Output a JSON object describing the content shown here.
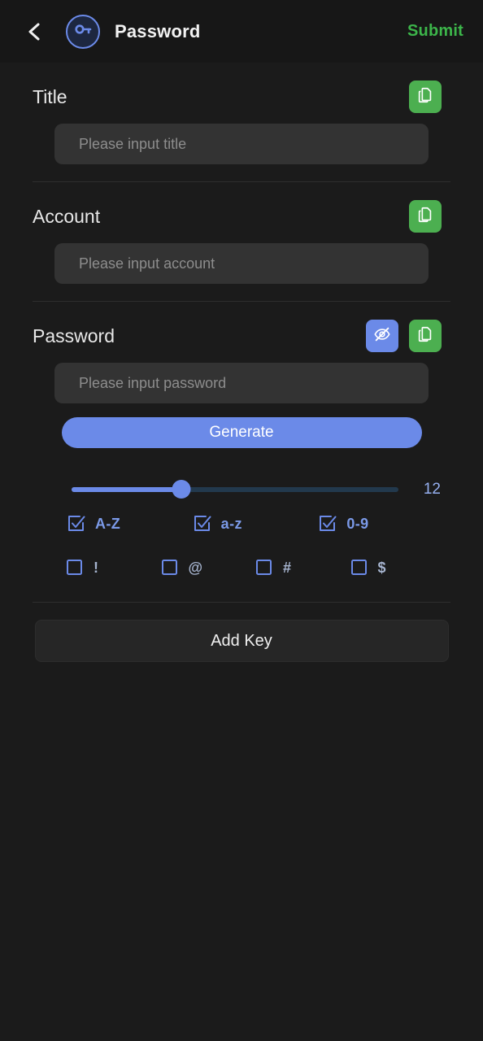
{
  "header": {
    "back_icon": "chevron-left-icon",
    "brand_icon": "key-icon",
    "title": "Password",
    "submit_label": "Submit"
  },
  "fields": [
    {
      "label": "Title",
      "placeholder": "Please input title",
      "value": "",
      "copy_icon": "copy-icon"
    },
    {
      "label": "Account",
      "placeholder": "Please input account",
      "value": "",
      "copy_icon": "copy-icon"
    },
    {
      "label": "Password",
      "placeholder": "Please input password",
      "value": "",
      "copy_icon": "copy-icon",
      "visibility_icon": "eye-off-icon"
    }
  ],
  "generator": {
    "generate_label": "Generate",
    "length_value": "12",
    "slider_percent": 33.7,
    "charset_row1": [
      {
        "label": "A-Z",
        "checked": true
      },
      {
        "label": "a-z",
        "checked": true
      },
      {
        "label": "0-9",
        "checked": true
      }
    ],
    "charset_row2": [
      {
        "label": "!",
        "checked": false
      },
      {
        "label": "@",
        "checked": false
      },
      {
        "label": "#",
        "checked": false
      },
      {
        "label": "$",
        "checked": false
      }
    ]
  },
  "footer": {
    "add_key_label": "Add Key"
  },
  "colors": {
    "background": "#1b1b1b",
    "header_background": "#171717",
    "accent_blue": "#6b8ae8",
    "accent_green": "#4caf50",
    "submit_green": "#3cb54a",
    "input_background": "#333333",
    "slider_track": "#22394d"
  }
}
